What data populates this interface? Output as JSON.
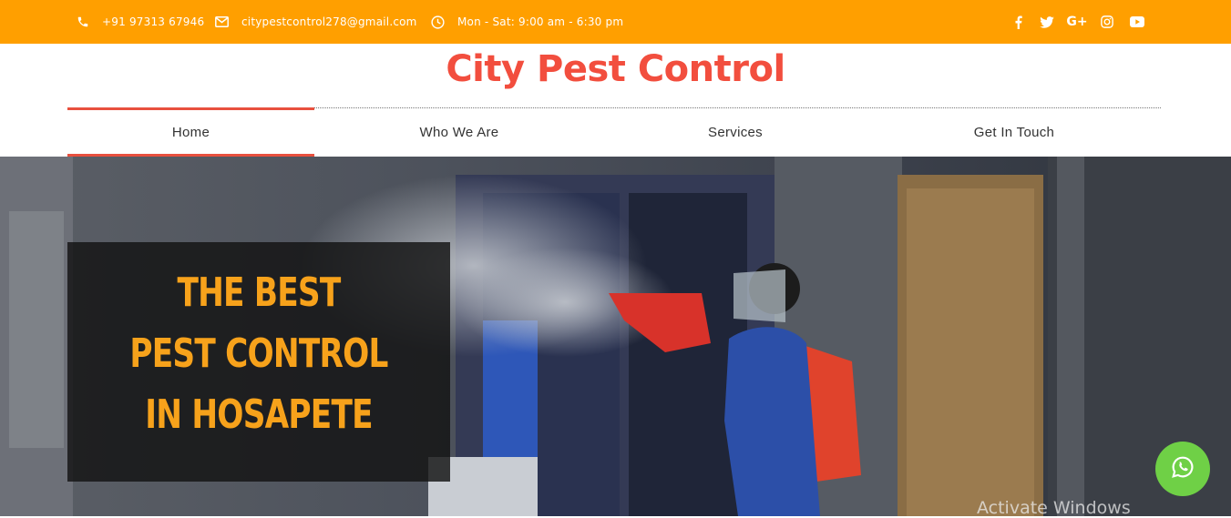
{
  "topbar": {
    "phone": "+91 97313 67946",
    "email": "citypestcontrol278@gmail.com",
    "hours": "Mon - Sat: 9:00 am - 6:30 pm",
    "social_icons": [
      "facebook-icon",
      "twitter-icon",
      "google-plus-icon",
      "instagram-icon",
      "youtube-icon"
    ]
  },
  "brand": {
    "name": "City Pest Control",
    "color": "#f24e3e"
  },
  "nav": {
    "tabs": [
      {
        "label": "Home",
        "active": true
      },
      {
        "label": "Who We Are"
      },
      {
        "label": "Services"
      },
      {
        "label": "Get In Touch"
      }
    ]
  },
  "hero": {
    "lines": [
      "THE BEST",
      "PEST CONTROL",
      "IN HOSAPETE"
    ]
  },
  "whatsapp": {
    "icon": "whatsapp-icon"
  },
  "watermark": "Activate Windows",
  "colors": {
    "topbar": "#ff9f00",
    "accent": "#f24e3e",
    "hero_text": "#f7a21b",
    "whatsapp": "#6fd046"
  }
}
